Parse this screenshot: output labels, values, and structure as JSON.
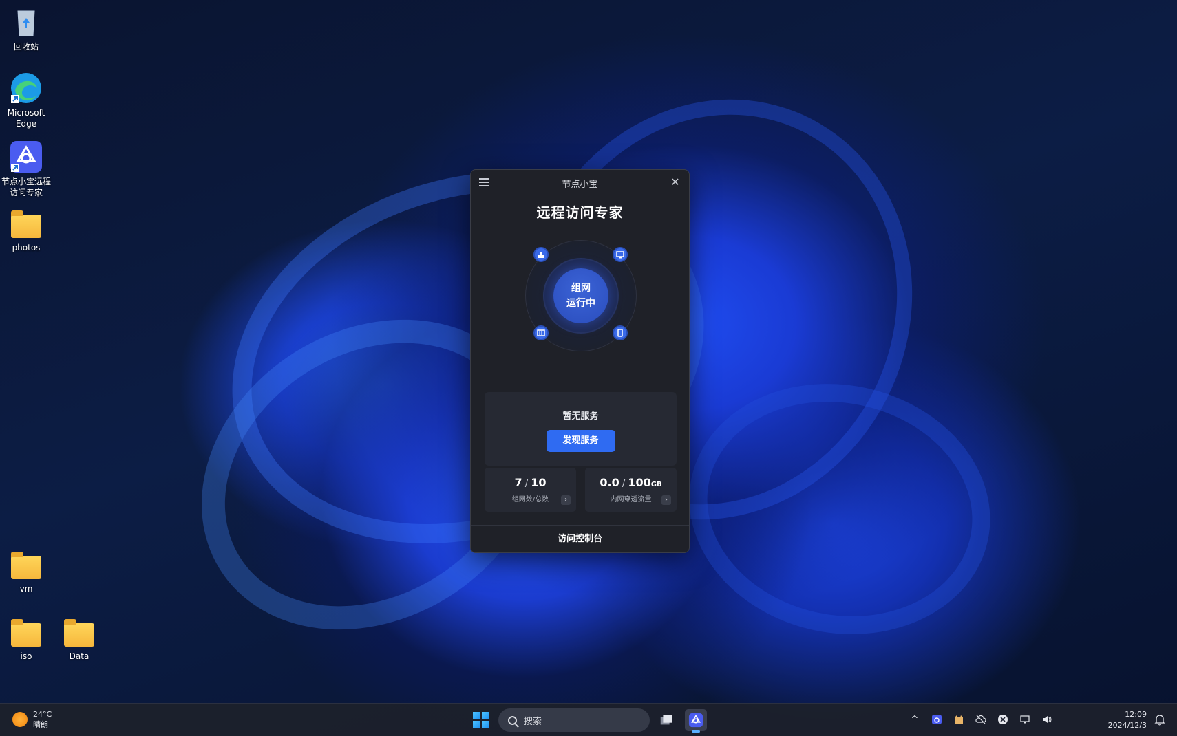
{
  "desktop": {
    "icons": [
      {
        "label": "回收站",
        "icon": "recycle-bin-icon"
      },
      {
        "label": "Microsoft Edge",
        "icon": "edge-icon"
      },
      {
        "label": "节点小宝远程访问专家",
        "icon": "jiedian-app-icon"
      },
      {
        "label": "photos",
        "icon": "folder-icon"
      },
      {
        "label": "vm",
        "icon": "folder-icon"
      },
      {
        "label": "iso",
        "icon": "folder-icon"
      },
      {
        "label": "Data",
        "icon": "folder-icon"
      }
    ]
  },
  "app": {
    "title": "节点小宝",
    "close_glyph": "✕",
    "heading": "远程访问专家",
    "status": {
      "line1": "组网",
      "line2": "运行中"
    },
    "nodes": [
      "router-icon",
      "monitor-icon",
      "nas-icon",
      "phone-icon"
    ],
    "service": {
      "title": "暂无服务",
      "button": "发现服务"
    },
    "stats": [
      {
        "value": "7",
        "sep": " / ",
        "total": "10",
        "unit": "",
        "label": "组网数/总数"
      },
      {
        "value": "0.0",
        "sep": " / ",
        "total": "100",
        "unit": "GB",
        "label": "内网穿透流量"
      }
    ],
    "arrow_glyph": "›",
    "footer": "访问控制台",
    "accent": "#2f6bf2"
  },
  "taskbar": {
    "weather": {
      "temp": "24°C",
      "condition": "晴朗"
    },
    "search_placeholder": "搜索",
    "tray_chevron": "^",
    "clock": {
      "time": "12:09",
      "date": "2024/12/3"
    }
  }
}
